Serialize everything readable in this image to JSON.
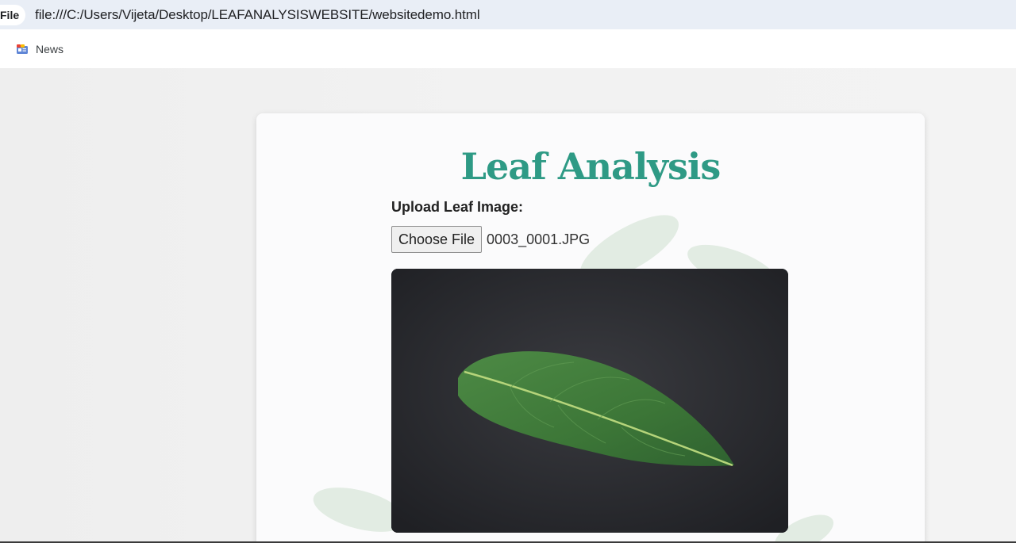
{
  "browser": {
    "scheme_chip": "File",
    "url": "file:///C:/Users/Vijeta/Desktop/LEAFANALYSISWEBSITE/websitedemo.html"
  },
  "bookmarks": {
    "items": [
      {
        "label": "News",
        "icon": "news-icon"
      }
    ]
  },
  "main": {
    "title": "Leaf Analysis",
    "upload_label": "Upload Leaf Image:",
    "choose_button": "Choose File",
    "selected_file": "0003_0001.JPG",
    "preview_alt": "leaf-image"
  },
  "colors": {
    "title": "#2e9a85",
    "address_bar": "#e9eef6",
    "preview_bg": "#2a2b30",
    "leaf": "#3e7a3a"
  }
}
